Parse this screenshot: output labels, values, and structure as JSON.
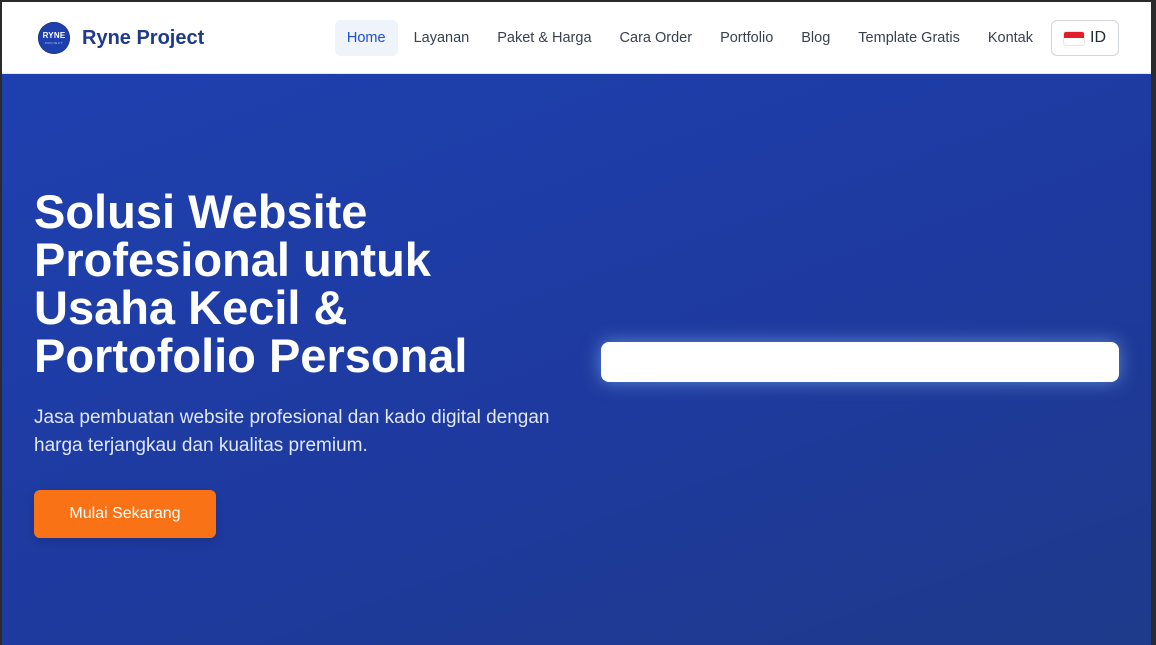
{
  "brand": {
    "logo_text": "RYNE",
    "logo_subtext": "PROJECT",
    "name": "Ryne Project"
  },
  "nav": {
    "items": [
      {
        "label": "Home",
        "active": true
      },
      {
        "label": "Layanan"
      },
      {
        "label": "Paket & Harga"
      },
      {
        "label": "Cara Order"
      },
      {
        "label": "Portfolio"
      },
      {
        "label": "Blog"
      },
      {
        "label": "Template Gratis"
      },
      {
        "label": "Kontak"
      }
    ],
    "language": {
      "label": "ID",
      "flag": "indonesia-flag"
    }
  },
  "hero": {
    "title": "Solusi Website Profesional untuk Usaha Kecil & Portofolio Personal",
    "subtitle": "Jasa pembuatan website profesional dan kado digital dengan harga terjangkau dan kualitas premium.",
    "cta_label": "Mulai Sekarang"
  },
  "colors": {
    "hero_bg": "#1e40af",
    "cta": "#f97316",
    "brand": "#1e3a8a",
    "active_nav_text": "#1d4ed8"
  }
}
